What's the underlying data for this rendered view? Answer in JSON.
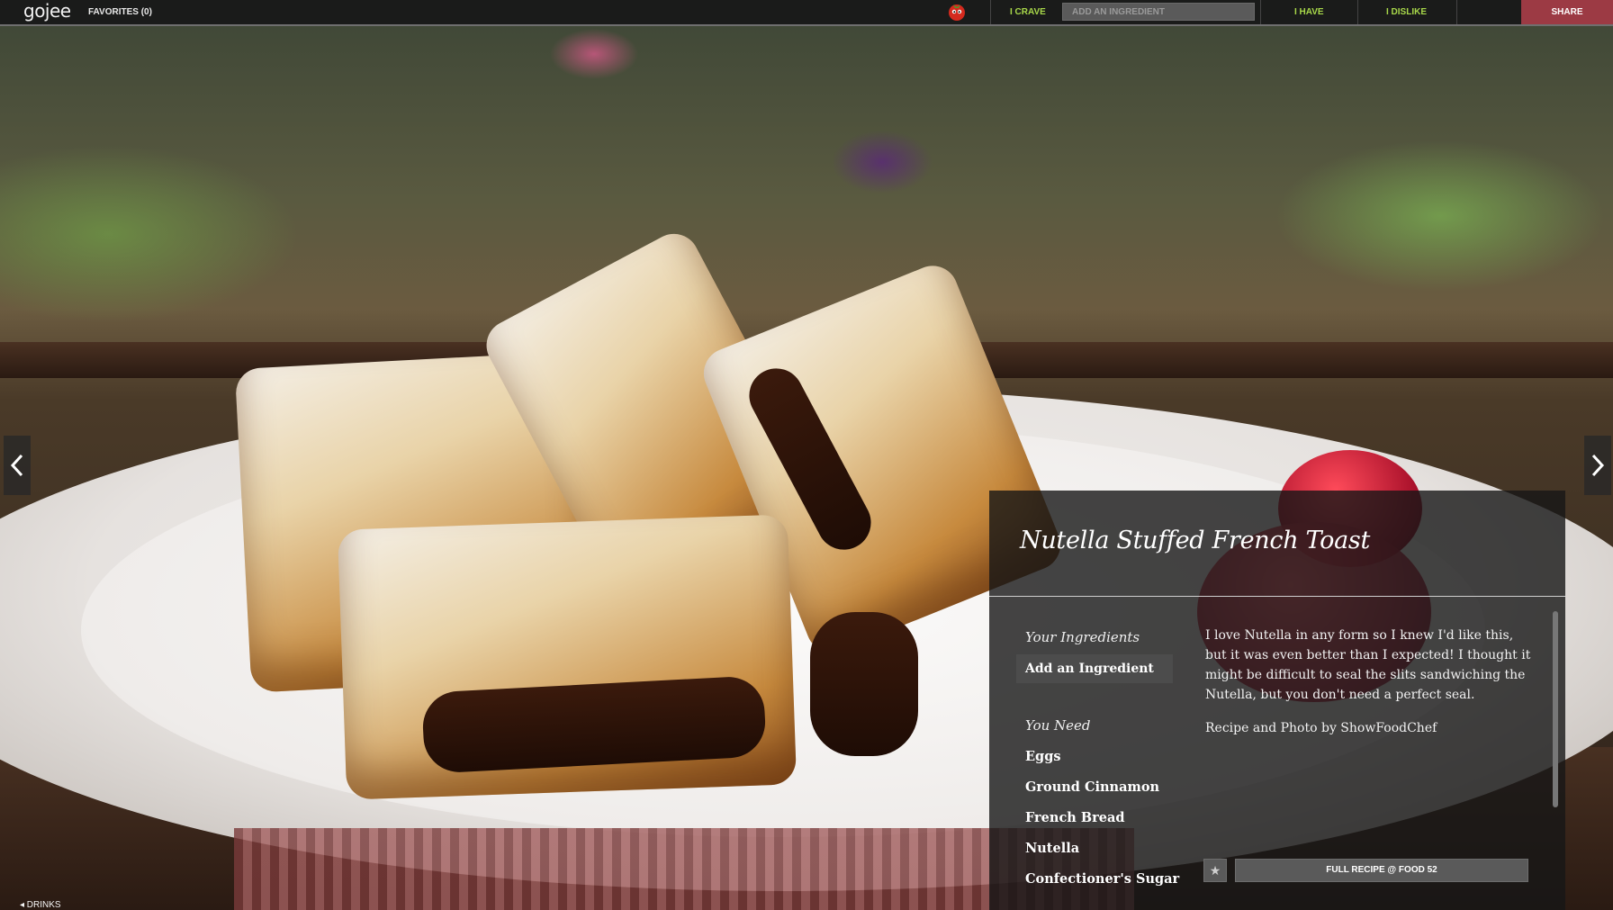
{
  "topbar": {
    "logo": "gojee",
    "favorites": "FAVORITES (0)",
    "mascot_icon": "tomato-mascot-icon",
    "crave": "I CRAVE",
    "ingredient_placeholder": "ADD AN INGREDIENT",
    "have": "I HAVE",
    "dislike": "I DISLIKE",
    "share": "SHARE"
  },
  "nav": {
    "prev_icon": "chevron-left-icon",
    "next_icon": "chevron-right-icon",
    "drinks": "◂ DRINKS"
  },
  "recipe": {
    "title": "Nutella Stuffed French Toast",
    "your_ingredients_heading": "Your Ingredients",
    "add_ingredient": "Add an Ingredient",
    "you_need_heading": "You Need",
    "ingredients": [
      "Eggs",
      "Ground Cinnamon",
      "French Bread",
      "Nutella",
      "Confectioner's Sugar"
    ],
    "description": "I love Nutella in any form so I knew I'd like this, but it was even better than I expected! I thought it might be difficult to seal the slits sandwiching the Nutella, but you don't need a perfect seal.",
    "credit": "Recipe and Photo by ShowFoodChef",
    "star_icon": "star-icon",
    "full_recipe": "FULL RECIPE @ FOOD 52"
  },
  "colors": {
    "accent_green": "#a8d84a",
    "share_red": "#9c3a44",
    "panel_bg": "#161616"
  }
}
